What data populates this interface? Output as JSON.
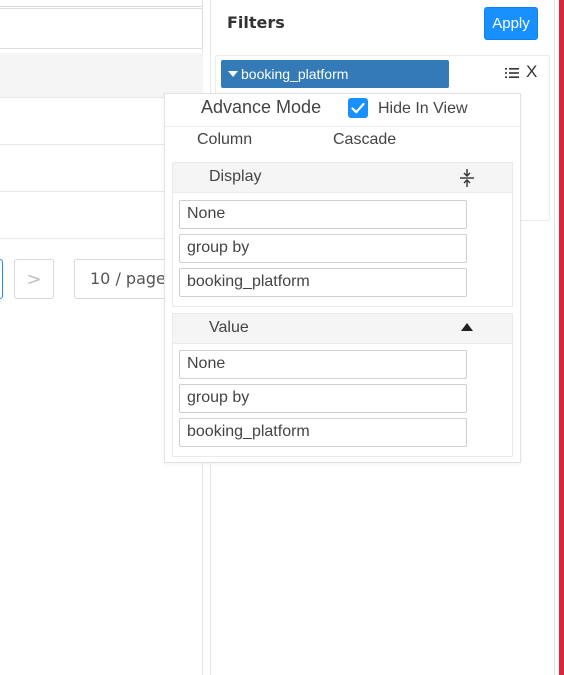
{
  "pagination": {
    "next_label": ">",
    "page_size_label": "10 / page"
  },
  "filters": {
    "title": "Filters",
    "apply_label": "Apply",
    "field_tag": "booking_platform",
    "close_label": "X"
  },
  "popover": {
    "advance_mode_label": "Advance Mode",
    "hide_in_view_label": "Hide In View",
    "hide_in_view_checked": true,
    "tabs": [
      "Column",
      "Cascade"
    ],
    "display": {
      "title": "Display",
      "fields": [
        "None",
        "group by",
        "booking_platform"
      ]
    },
    "value": {
      "title": "Value",
      "fields": [
        "None",
        "group by",
        "booking_platform"
      ]
    }
  },
  "colors": {
    "accent": "#1890ff",
    "tag_bg": "#337ab7",
    "edge_red": "#d9263b"
  }
}
